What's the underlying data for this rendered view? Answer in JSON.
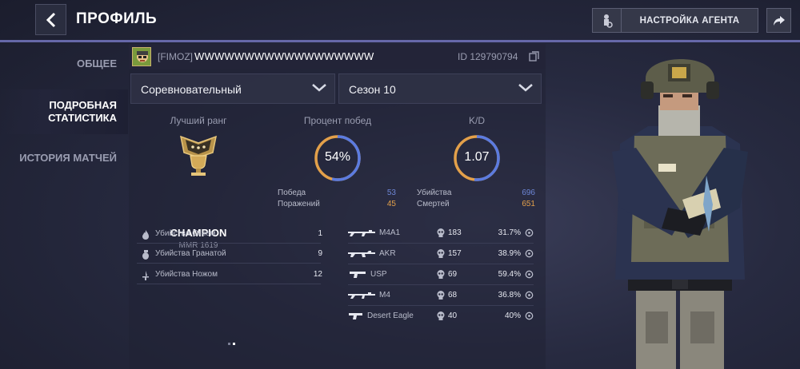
{
  "header": {
    "title": "ПРОФИЛЬ",
    "agent_button": "НАСТРОЙКА АГЕНТА"
  },
  "nav": {
    "items": [
      {
        "label": "ОБЩЕЕ"
      },
      {
        "label": "ПОДРОБНАЯ\nСТАТИСТИКА"
      },
      {
        "label": "ИСТОРИЯ МАТЧЕЙ"
      }
    ]
  },
  "player": {
    "clan": "[FIMOZ]",
    "name": "WWWWWWWWWWWWWWWWWW",
    "id": "ID 129790794"
  },
  "filters": {
    "mode": "Соревновательный",
    "season": "Сезон 10"
  },
  "rank": {
    "title": "Лучший ранг",
    "name": "CHAMPION",
    "mmr": "MMR 1619"
  },
  "winrate": {
    "title": "Процент побед",
    "value": "54%",
    "fraction": 0.54,
    "wins_label": "Победа",
    "wins": "53",
    "losses_label": "Поражений",
    "losses": "45"
  },
  "kd": {
    "title": "K/D",
    "value": "1.07",
    "fraction": 0.517,
    "kills_label": "Убийства",
    "kills": "696",
    "deaths_label": "Смертей",
    "deaths": "651"
  },
  "special_kills": [
    {
      "label": "Убийства Огнем",
      "value": "1",
      "icon": "fire-icon"
    },
    {
      "label": "Убийства Гранатой",
      "value": "9",
      "icon": "grenade-icon"
    },
    {
      "label": "Убийства Ножом",
      "value": "12",
      "icon": "knife-icon"
    }
  ],
  "weapons": [
    {
      "name": "M4A1",
      "kills": "183",
      "pct": "31.7%"
    },
    {
      "name": "AKR",
      "kills": "157",
      "pct": "38.9%"
    },
    {
      "name": "USP",
      "kills": "69",
      "pct": "59.4%"
    },
    {
      "name": "M4",
      "kills": "68",
      "pct": "36.8%"
    },
    {
      "name": "Desert Eagle",
      "kills": "40",
      "pct": "40%"
    }
  ],
  "colors": {
    "accent": "#6e70b6",
    "ring_blue": "#5b7be0",
    "ring_orange": "#e3a04a",
    "wins": "#6d86d6",
    "losses": "#e3a04a"
  }
}
